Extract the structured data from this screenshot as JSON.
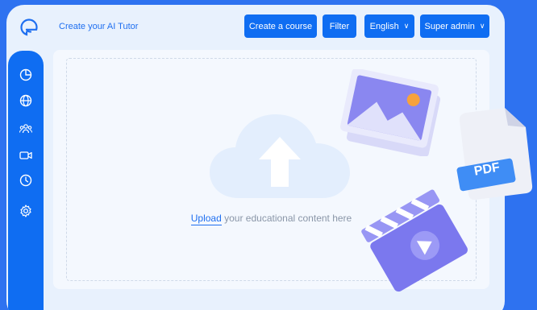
{
  "header": {
    "app_title": "Create your AI Tutor",
    "buttons": {
      "create_course": "Create a course",
      "filter": "Filter",
      "language": "English",
      "role": "Super admin"
    }
  },
  "sidebar": {
    "items": [
      "dashboard-icon",
      "globe-icon",
      "users-icon",
      "video-icon",
      "clock-icon",
      "settings-icon"
    ]
  },
  "upload": {
    "link_text": "Upload",
    "rest_text": " your educational content here"
  },
  "decorations": {
    "pdf_label": "PDF"
  },
  "colors": {
    "background": "#2e72f0",
    "panel": "#e8f1fd",
    "accent": "#0f6df2",
    "deco_purple": "#7b78ee"
  }
}
